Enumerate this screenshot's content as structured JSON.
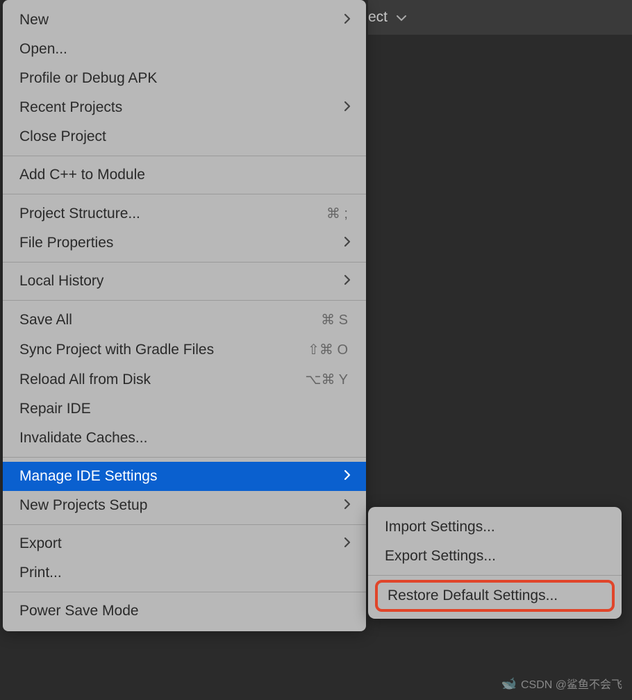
{
  "background": {
    "partial_text": "ect"
  },
  "menu": {
    "items": [
      {
        "label": "New",
        "has_submenu": true
      },
      {
        "label": "Open..."
      },
      {
        "label": "Profile or Debug APK"
      },
      {
        "label": "Recent Projects",
        "has_submenu": true
      },
      {
        "label": "Close Project"
      },
      {
        "sep": true
      },
      {
        "label": "Add C++ to Module"
      },
      {
        "sep": true
      },
      {
        "label": "Project Structure...",
        "shortcut": "⌘ ;"
      },
      {
        "label": "File Properties",
        "has_submenu": true
      },
      {
        "sep": true
      },
      {
        "label": "Local History",
        "has_submenu": true
      },
      {
        "sep": true
      },
      {
        "label": "Save All",
        "shortcut": "⌘ S"
      },
      {
        "label": "Sync Project with Gradle Files",
        "shortcut": "⇧⌘ O"
      },
      {
        "label": "Reload All from Disk",
        "shortcut": "⌥⌘ Y"
      },
      {
        "label": "Repair IDE"
      },
      {
        "label": "Invalidate Caches..."
      },
      {
        "sep": true
      },
      {
        "label": "Manage IDE Settings",
        "has_submenu": true,
        "selected": true
      },
      {
        "label": "New Projects Setup",
        "has_submenu": true
      },
      {
        "sep": true
      },
      {
        "label": "Export",
        "has_submenu": true
      },
      {
        "label": "Print..."
      },
      {
        "sep": true
      },
      {
        "label": "Power Save Mode"
      }
    ]
  },
  "submenu": {
    "items": [
      {
        "label": "Import Settings..."
      },
      {
        "label": "Export Settings..."
      },
      {
        "sep": true
      },
      {
        "label": "Restore Default Settings...",
        "highlighted": true
      }
    ]
  },
  "watermark": {
    "text": "CSDN @鲨鱼不会飞"
  }
}
